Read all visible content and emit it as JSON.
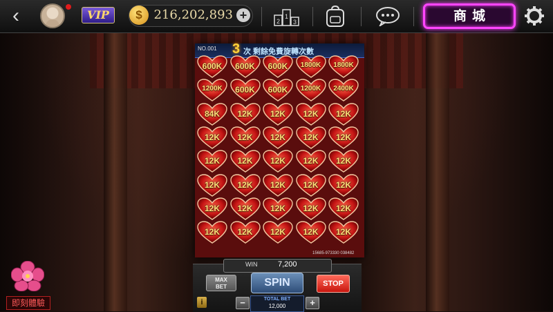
{
  "topbar": {
    "back_icon": "back-arrow-icon",
    "vip_label": "VIP",
    "coin_symbol": "$",
    "coin_balance": "216,202,893",
    "add_coins_symbol": "+",
    "rank_icon": "leaderboard-icon",
    "rank_digits": [
      "2",
      "1",
      "3"
    ],
    "bag_icon": "backpack-icon",
    "chat_icon": "chat-bubble-icon",
    "shop_label": "商城",
    "settings_icon": "gear-icon"
  },
  "slot": {
    "machine_no": "NO.001",
    "free_spins_count": "3",
    "free_spins_text": "次 剩餘免費旋轉次數",
    "serial": "15685-973330 038482",
    "rows": [
      [
        "600K",
        "600K",
        "600K",
        "1800K",
        "1800K"
      ],
      [
        "1200K",
        "600K",
        "600K",
        "1200K",
        "2400K"
      ],
      [
        "84K",
        "12K",
        "12K",
        "12K",
        "12K"
      ],
      [
        "12K",
        "12K",
        "12K",
        "12K",
        "12K"
      ],
      [
        "12K",
        "12K",
        "12K",
        "12K",
        "12K"
      ],
      [
        "12K",
        "12K",
        "12K",
        "12K",
        "12K"
      ],
      [
        "12K",
        "12K",
        "12K",
        "12K",
        "12K"
      ],
      [
        "12K",
        "12K",
        "12K",
        "12K",
        "12K"
      ]
    ]
  },
  "controls": {
    "win_label": "WIN",
    "win_value": "7,200",
    "max_bet_label_1": "MAX",
    "max_bet_label_2": "BET",
    "spin_label": "SPIN",
    "stop_label": "STOP",
    "info_label": "i",
    "decrease_label": "−",
    "increase_label": "+",
    "total_bet_label": "TOTAL BET",
    "total_bet_value": "12,000"
  },
  "promo": {
    "flower_icon": "flower-icon",
    "trial_label": "即刻體驗"
  },
  "colors": {
    "shop_neon": "#ff45ff",
    "coin_gold": "#ffd86a",
    "heart_red": "#c41414",
    "spin_blue": "#2e4d78",
    "stop_red": "#c8160e"
  }
}
